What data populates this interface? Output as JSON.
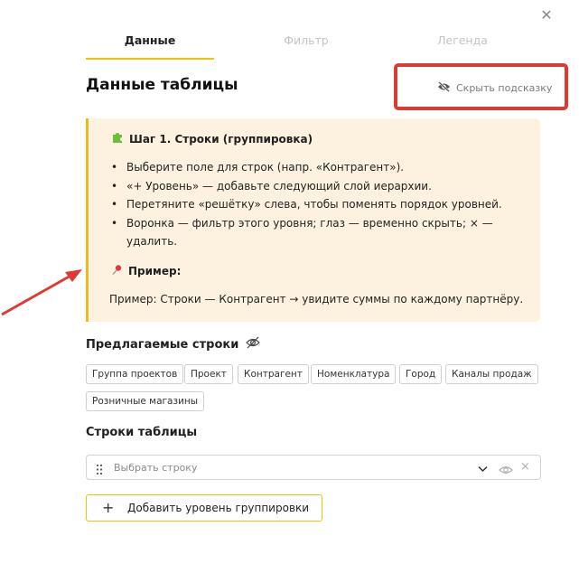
{
  "tabs": [
    {
      "label": "Данные"
    },
    {
      "label": "Фильтр"
    },
    {
      "label": "Легенда"
    }
  ],
  "header": {
    "title": "Данные таблицы",
    "hide_hint_label": "Скрыть подсказку"
  },
  "hint": {
    "step_title": "Шаг 1. Строки (группировка)",
    "items": [
      "Выберите поле для строк (напр. «Контрагент»).",
      "«+ Уровень» — добавьте следующий слой иерархии.",
      "Перетяните «решётку» слева, чтобы поменять порядок уровней.",
      "Воронка — фильтр этого уровня; глаз — временно скрыть; × — удалить."
    ],
    "example_title": "Пример:",
    "example_text": "Пример: Строки — Контрагент → увидите суммы по каждому партнёру."
  },
  "suggested": {
    "title": "Предлагаемые строки",
    "chips": [
      "Группа проектов",
      "Проект",
      "Контрагент",
      "Номенклатура",
      "Город",
      "Каналы продаж",
      "Розничные магазины"
    ]
  },
  "rows": {
    "title": "Строки таблицы",
    "select_placeholder": "Выбрать строку"
  },
  "add_level_label": "Добавить уровень группировки",
  "colors": {
    "accent": "#f1c400",
    "highlight": "#dc3b34",
    "hint_bg": "#fdf2df"
  }
}
